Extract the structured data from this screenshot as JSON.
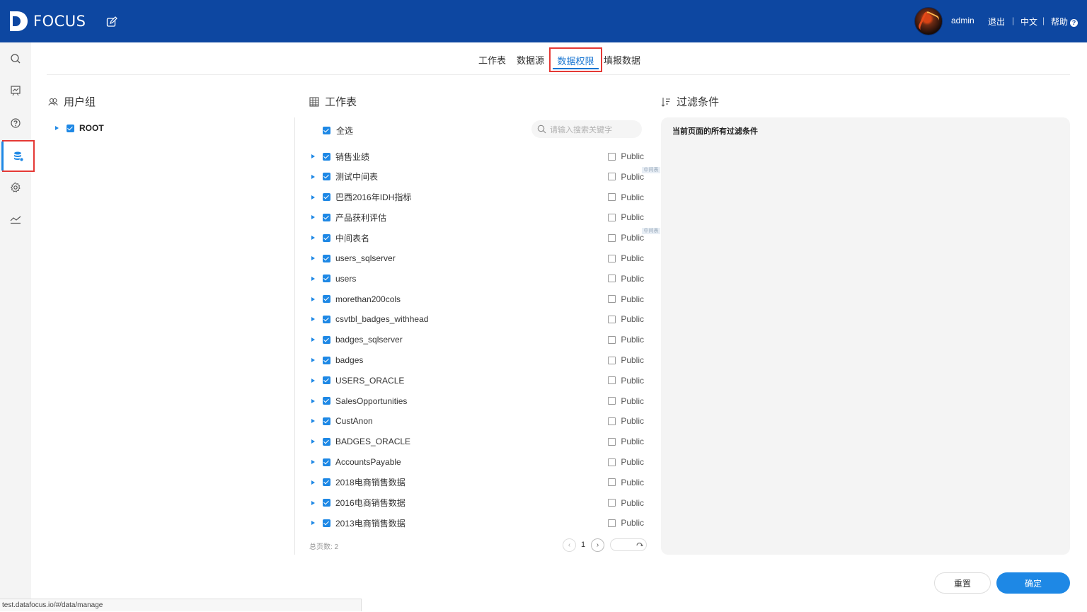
{
  "app": {
    "logo_text": "FOCUS"
  },
  "topbar": {
    "user": "admin",
    "logout": "退出",
    "separator": "|",
    "language": "中文",
    "help": "帮助",
    "help_icon": "?"
  },
  "sidebar": {
    "items": [
      {
        "icon": "search-icon"
      },
      {
        "icon": "board-icon"
      },
      {
        "icon": "question-icon"
      },
      {
        "icon": "database-icon",
        "active": true
      },
      {
        "icon": "gear-icon"
      },
      {
        "icon": "trend-icon"
      }
    ]
  },
  "tabs": [
    {
      "label": "工作表"
    },
    {
      "label": "数据源"
    },
    {
      "label": "数据权限",
      "active": true
    },
    {
      "label": "填报数据"
    }
  ],
  "users_panel": {
    "title": "用户组",
    "root_label": "ROOT",
    "root_checked": true
  },
  "worksheet_panel": {
    "title": "工作表",
    "select_all_label": "全选",
    "select_all_checked": true,
    "search_placeholder": "请输入搜索关键字",
    "public_label": "Public",
    "tag_label": "中间表",
    "rows": [
      {
        "name": "销售业绩",
        "checked": true,
        "public": false
      },
      {
        "name": "测试中间表",
        "checked": true,
        "public": false
      },
      {
        "name": "巴西2016年IDH指标",
        "checked": true,
        "public": false
      },
      {
        "name": "产品获利评估",
        "checked": true,
        "public": false
      },
      {
        "name": "中间表名",
        "checked": true,
        "public": false
      },
      {
        "name": "users_sqlserver",
        "checked": true,
        "public": false
      },
      {
        "name": "users",
        "checked": true,
        "public": false
      },
      {
        "name": "morethan200cols",
        "checked": true,
        "public": false
      },
      {
        "name": "csvtbl_badges_withhead",
        "checked": true,
        "public": false
      },
      {
        "name": "badges_sqlserver",
        "checked": true,
        "public": false
      },
      {
        "name": "badges",
        "checked": true,
        "public": false
      },
      {
        "name": "USERS_ORACLE",
        "checked": true,
        "public": false
      },
      {
        "name": "SalesOpportunities",
        "checked": true,
        "public": false
      },
      {
        "name": "CustAnon",
        "checked": true,
        "public": false
      },
      {
        "name": "BADGES_ORACLE",
        "checked": true,
        "public": false
      },
      {
        "name": "AccountsPayable",
        "checked": true,
        "public": false
      },
      {
        "name": "2018电商销售数据",
        "checked": true,
        "public": false
      },
      {
        "name": "2016电商销售数据",
        "checked": true,
        "public": false
      },
      {
        "name": "2013电商销售数据",
        "checked": true,
        "public": false
      }
    ],
    "total_pages_label": "总页数: 2",
    "current_page": "1"
  },
  "filter_panel": {
    "title": "过滤条件",
    "subtitle": "当前页面的所有过滤条件"
  },
  "buttons": {
    "reset": "重置",
    "confirm": "确定"
  },
  "status_url": "test.datafocus.io/#/data/manage",
  "colors": {
    "topbar": "#0d47a1",
    "accent": "#1e88e5",
    "highlight": "#e53935"
  }
}
